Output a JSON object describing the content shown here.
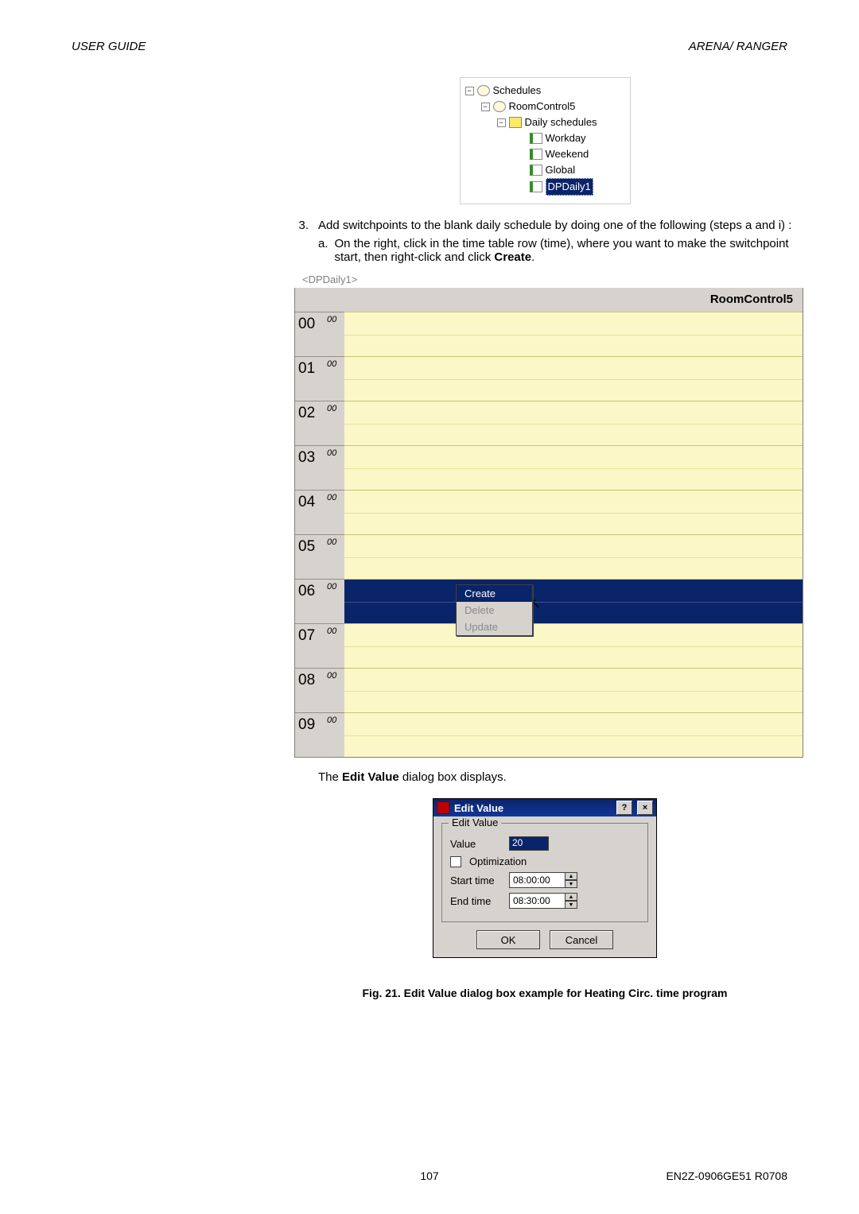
{
  "header": {
    "left": "USER GUIDE",
    "right": "ARENA/ RANGER"
  },
  "tree": {
    "schedules": "Schedules",
    "room": "RoomControl5",
    "daily_group": "Daily schedules",
    "items": [
      "Workday",
      "Weekend",
      "Global",
      "DPDaily1"
    ],
    "selected_index": 3
  },
  "step": {
    "number": "3.",
    "text1": "Add switchpoints to the blank daily schedule by doing one of the following (steps a and i) :",
    "sub_letter": "a.",
    "sub_text": "On the right, click in the time table row (time), where you want to make the switchpoint start, then right-click and click ",
    "sub_bold": "Create",
    "sub_end": "."
  },
  "sched": {
    "title": "<DPDaily1>",
    "column": "RoomControl5",
    "hours": [
      "00",
      "01",
      "02",
      "03",
      "04",
      "05",
      "06",
      "07",
      "08",
      "09"
    ],
    "minute_label": "00",
    "selected_hour_index": 6,
    "ctx": {
      "create": "Create",
      "delete": "Delete",
      "update": "Update"
    }
  },
  "after_text": {
    "pre": "The ",
    "bold": "Edit Value",
    "post": " dialog box displays."
  },
  "dialog": {
    "title": "Edit Value",
    "group_label": "Edit Value",
    "value_label": "Value",
    "value_text": "20",
    "opt_label": "Optimization",
    "start_label": "Start time",
    "start_val": "08:00:00",
    "end_label": "End time",
    "end_val": "08:30:00",
    "ok": "OK",
    "cancel": "Cancel"
  },
  "caption": "Fig. 21.  Edit Value dialog box example for Heating Circ. time program",
  "footer": {
    "page": "107",
    "doc": "EN2Z-0906GE51 R0708"
  }
}
